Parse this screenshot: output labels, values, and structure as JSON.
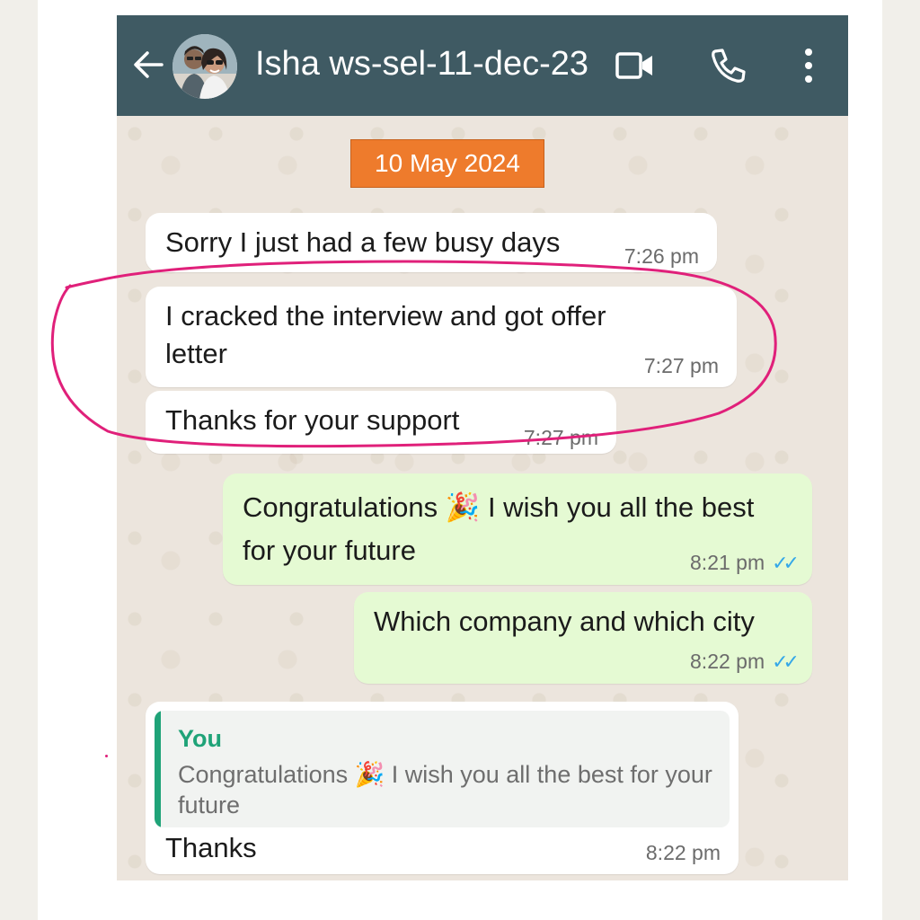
{
  "header": {
    "back_icon": "arrow-left-icon",
    "contact_name": "Isha ws-sel-11-dec-23",
    "video_icon": "video-camera-icon",
    "call_icon": "phone-icon",
    "menu_icon": "kebab-menu-icon",
    "bar_color": "#3f5a63"
  },
  "chat": {
    "date_label": "10 May 2024",
    "date_color": "#ee7b2c",
    "messages": [
      {
        "direction": "in",
        "text": "Sorry I just had a few busy days",
        "time": "7:26 pm"
      },
      {
        "direction": "in",
        "text": "I cracked the interview and got offer letter",
        "time": "7:27 pm"
      },
      {
        "direction": "in",
        "text": "Thanks for your support",
        "time": "7:27 pm"
      },
      {
        "direction": "out",
        "text": "Congratulations 🎉 I wish you all the best for your future",
        "time": "8:21 pm",
        "status": "read"
      },
      {
        "direction": "out",
        "text": "Which company and which city",
        "time": "8:22 pm",
        "status": "read"
      },
      {
        "direction": "in",
        "reply_to": {
          "author": "You",
          "text": "Congratulations 🎉 I wish you all the best for your future"
        },
        "text": "Thanks",
        "time": "8:22 pm"
      }
    ],
    "read_tick_color": "#34a7e8",
    "outgoing_bubble_color": "#e5fad3"
  },
  "annotation": {
    "stroke_color": "#e0207a"
  }
}
